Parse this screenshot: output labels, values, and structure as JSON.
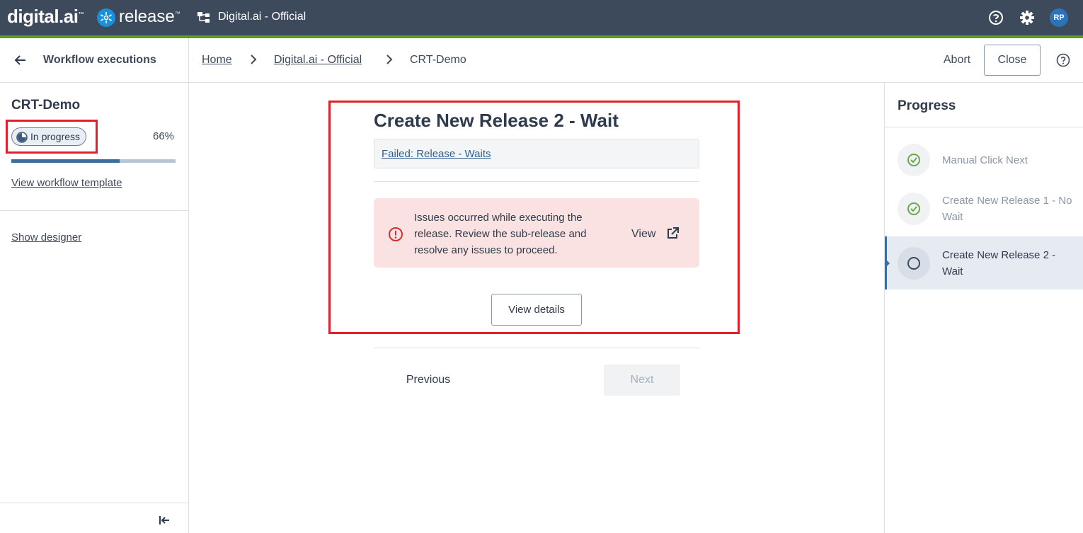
{
  "topbar": {
    "brand": "digital.ai",
    "product": "release",
    "folder_name": "Digital.ai - Official",
    "avatar_initials": "RP"
  },
  "sidebar": {
    "back_title": "Workflow executions",
    "workflow_name": "CRT-Demo",
    "status": "In progress",
    "progress_percent": 66,
    "progress_label": "66%",
    "view_template": "View workflow template",
    "show_designer": "Show designer"
  },
  "breadcrumb": {
    "items": [
      "Home",
      "Digital.ai - Official",
      "CRT-Demo"
    ],
    "abort": "Abort",
    "close": "Close"
  },
  "main": {
    "title": "Create New Release 2 - Wait",
    "info_link": "Failed: Release - Waits",
    "error_message": "Issues occurred while executing the release. Review the sub-release and resolve any issues to proceed.",
    "error_view": "View",
    "view_details": "View details",
    "previous": "Previous",
    "next": "Next"
  },
  "progress_panel": {
    "title": "Progress",
    "steps": [
      {
        "label": "Manual Click Next",
        "status": "completed"
      },
      {
        "label": "Create New Release 1 - No Wait",
        "status": "completed"
      },
      {
        "label": "Create New Release 2 - Wait",
        "status": "in-progress"
      }
    ]
  },
  "colors": {
    "topbar": "#3d4a5c",
    "accent_bar": "#5c9e1e",
    "highlight": "#e0202a",
    "error_bg": "#fbe2e2",
    "success": "#6aa84f"
  }
}
